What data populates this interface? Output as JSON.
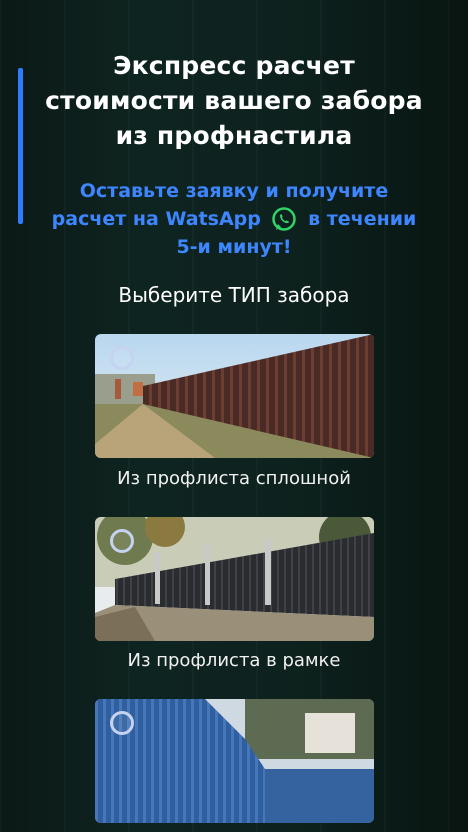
{
  "header": {
    "title_line1": "Экспресс расчет",
    "title_line2": "стоимости вашего забора",
    "title_line3": "из профнастила"
  },
  "subtitle": {
    "line1": "Оставьте заявку и получите",
    "line2_start": "расчет на WatsApp",
    "line2_end": "в течении",
    "line3": "5-и минут!",
    "accent_color": "#3d86ff",
    "icon": "whatsapp-icon"
  },
  "section": {
    "label": "Выберите ТИП забора"
  },
  "options": [
    {
      "caption": "Из профлиста сплошной",
      "selected": false
    },
    {
      "caption": "Из профлиста в рамке",
      "selected": false
    },
    {
      "caption": "",
      "selected": false
    }
  ]
}
